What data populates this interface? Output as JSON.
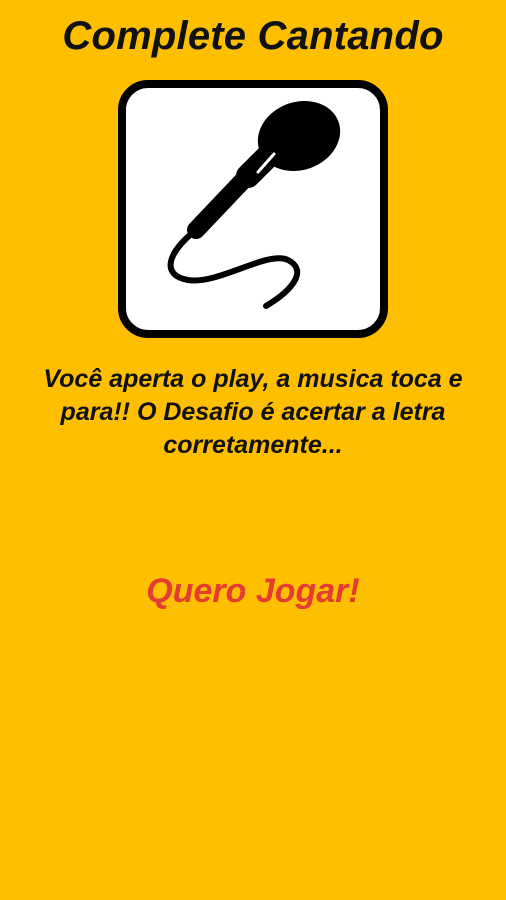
{
  "app": {
    "title": "Complete Cantando"
  },
  "logo": {
    "icon": "microphone-icon"
  },
  "intro": {
    "description": "Você aperta o play, a musica toca e para!! O Desafio é acertar a letra corretamente..."
  },
  "actions": {
    "play_label": "Quero Jogar!"
  },
  "colors": {
    "background": "#FDBF00",
    "text": "#111111",
    "accent": "#E53B33",
    "card": "#FFFFFF"
  }
}
